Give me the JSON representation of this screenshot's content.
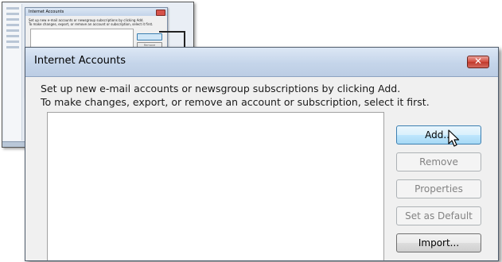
{
  "background_window": {
    "dialog_title": "Internet Accounts",
    "description_line1": "Set up new e-mail accounts or newsgroup subscriptions by clicking Add.",
    "description_line2": "To make changes, export, or remove an account or subscription, select it first.",
    "button_remove": "Remove"
  },
  "dialog": {
    "title": "Internet Accounts",
    "close_label": "✕",
    "description_line1": "Set up new e-mail accounts or newsgroup subscriptions by clicking Add.",
    "description_line2": "To make changes, export, or remove an account or subscription, select it first.",
    "accounts": [],
    "buttons": {
      "add": "Add...",
      "remove": "Remove",
      "properties": "Properties",
      "set_default": "Set as Default",
      "import": "Import..."
    }
  },
  "icons": {
    "close": "close-icon",
    "cursor": "mouse-pointer-icon"
  },
  "colors": {
    "titlebar": "#c5d5ea",
    "close_button": "#d24c3f",
    "hover_button": "#bee6fd",
    "dialog_bg": "#f0f0f0"
  }
}
